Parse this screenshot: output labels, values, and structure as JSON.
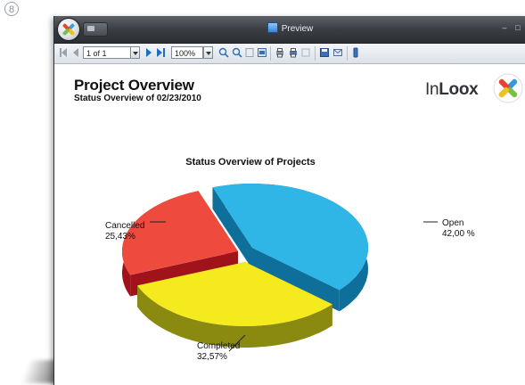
{
  "step_badge": "8",
  "window": {
    "title": "Preview",
    "minimize_glyph": "–",
    "maximize_glyph": "□"
  },
  "toolbar": {
    "page_value": "1 of 1",
    "zoom_value": "100%"
  },
  "report": {
    "title": "Project Overview",
    "subtitle": "Status Overview of 02/23/2010",
    "brand_prefix": "In",
    "brand_suffix": "Loox"
  },
  "chart_data": {
    "type": "pie",
    "title": "Status Overview of Projects",
    "slices": [
      {
        "label": "Open",
        "value": 42.0,
        "value_text": "42,00 %",
        "color": "#2fb6e6",
        "side_color": "#0d6f9a"
      },
      {
        "label": "Completed",
        "value": 32.57,
        "value_text": "32,57%",
        "color": "#f4ea1e",
        "side_color": "#8a8a10"
      },
      {
        "label": "Cancelled",
        "value": 25.43,
        "value_text": "25,43%",
        "color": "#ee4a3d",
        "side_color": "#a0131a"
      }
    ],
    "legend": "none",
    "style": "3d-exploded"
  }
}
